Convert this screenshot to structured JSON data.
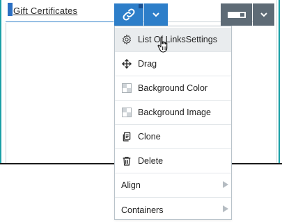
{
  "editor": {
    "link_text": "Gift Certificates"
  },
  "toolbar": {
    "link_tool_icon": "link-icon",
    "dropdown_icon": "chevron-down-icon",
    "block_tool_icon": "block-element-icon"
  },
  "context_menu": {
    "items": [
      {
        "label": "List Of LinksSettings",
        "icon": "gear-icon",
        "submenu": false
      },
      {
        "label": "Drag",
        "icon": "move-arrows-icon",
        "submenu": false
      },
      {
        "label": "Background Color",
        "icon": "checkerboard-icon",
        "submenu": false
      },
      {
        "label": "Background Image",
        "icon": "checkerboard-icon",
        "submenu": false
      },
      {
        "label": "Clone",
        "icon": "clone-icon",
        "submenu": false
      },
      {
        "label": "Delete",
        "icon": "trash-icon",
        "submenu": false
      },
      {
        "label": "Align",
        "icon": "",
        "submenu": true
      },
      {
        "label": "Containers",
        "icon": "",
        "submenu": true
      }
    ]
  },
  "colors": {
    "accent_blue": "#2d7ec9",
    "tool_gray": "#5e6b76",
    "frame_teal": "#1aa0a7"
  }
}
